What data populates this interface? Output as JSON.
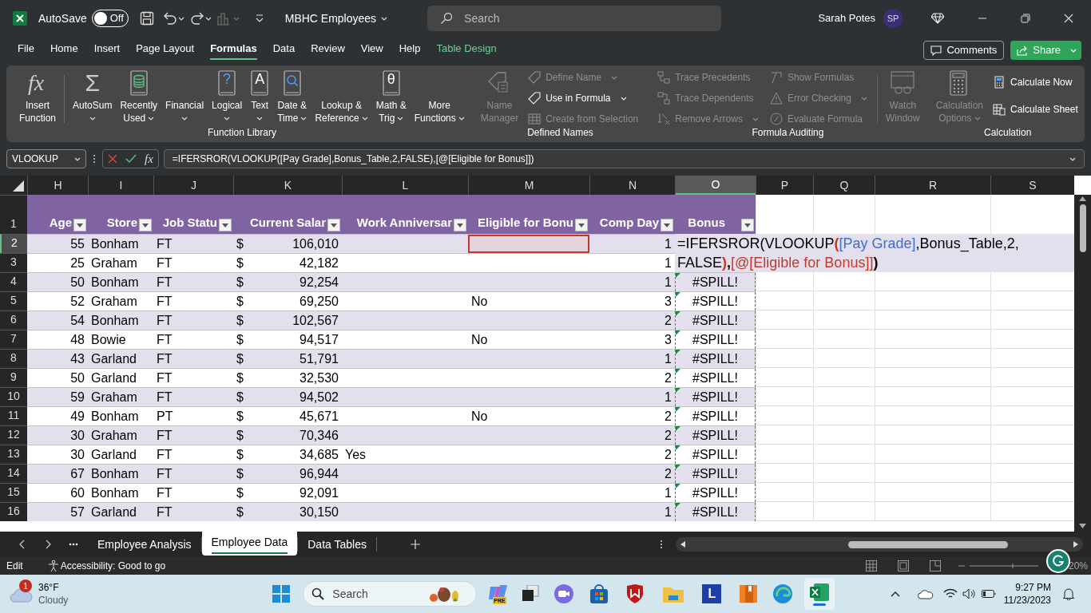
{
  "title_bar": {
    "autosave_label": "AutoSave",
    "autosave": {
      "on": false,
      "label": "Off"
    },
    "file_name": "MBHC Employees",
    "search": {
      "placeholder": "Search"
    },
    "user_name": "Sarah Potes",
    "avatar": "SP"
  },
  "menu_tabs": [
    {
      "label": "File",
      "selected": false,
      "contextual": false
    },
    {
      "label": "Home",
      "selected": false,
      "contextual": false
    },
    {
      "label": "Insert",
      "selected": false,
      "contextual": false
    },
    {
      "label": "Page Layout",
      "selected": false,
      "contextual": false
    },
    {
      "label": "Formulas",
      "selected": true,
      "contextual": false
    },
    {
      "label": "Data",
      "selected": false,
      "contextual": false
    },
    {
      "label": "Review",
      "selected": false,
      "contextual": false
    },
    {
      "label": "View",
      "selected": false,
      "contextual": false
    },
    {
      "label": "Help",
      "selected": false,
      "contextual": false
    },
    {
      "label": "Table Design",
      "selected": false,
      "contextual": true
    }
  ],
  "header_buttons": {
    "comments": "Comments",
    "share": "Share"
  },
  "ribbon": {
    "groups": [
      {
        "label": "Function Library",
        "items": [
          {
            "kind": "large",
            "lines": [
              "Insert",
              "Function"
            ],
            "glyph": "fx",
            "disabled": false,
            "dropdown": false
          },
          {
            "kind": "separator"
          },
          {
            "kind": "large",
            "lines": [
              "AutoSum"
            ],
            "glyph": "Σ",
            "disabled": false,
            "dropdown": true
          },
          {
            "kind": "large",
            "lines": [
              "Recently",
              "Used"
            ],
            "disabled": false,
            "dropdown": true
          },
          {
            "kind": "large",
            "lines": [
              "Financial"
            ],
            "disabled": false,
            "dropdown": true
          },
          {
            "kind": "large",
            "lines": [
              "Logical"
            ],
            "glyph": "?",
            "disabled": false,
            "dropdown": true
          },
          {
            "kind": "large",
            "lines": [
              "Text"
            ],
            "glyph": "A",
            "disabled": false,
            "dropdown": true
          },
          {
            "kind": "large",
            "lines": [
              "Date &",
              "Time"
            ],
            "disabled": false,
            "dropdown": true
          },
          {
            "kind": "large",
            "lines": [
              "Lookup &",
              "Reference"
            ],
            "disabled": false,
            "dropdown": true
          },
          {
            "kind": "large",
            "lines": [
              "Math &",
              "Trig"
            ],
            "glyph": "θ",
            "disabled": false,
            "dropdown": true
          },
          {
            "kind": "large",
            "lines": [
              "More",
              "Functions"
            ],
            "disabled": false,
            "dropdown": true
          }
        ]
      },
      {
        "label": "Defined Names",
        "items": [
          {
            "kind": "large",
            "lines": [
              "Name",
              "Manager"
            ],
            "disabled": true,
            "dropdown": false
          },
          {
            "kind": "stack",
            "items": [
              {
                "label": "Define Name",
                "disabled": true,
                "dropdown": true
              },
              {
                "label": "Use in Formula",
                "disabled": false,
                "dropdown": true
              },
              {
                "label": "Create from Selection",
                "disabled": true,
                "dropdown": false
              }
            ]
          }
        ]
      },
      {
        "label": "Formula Auditing",
        "items": [
          {
            "kind": "stack",
            "items": [
              {
                "label": "Trace Precedents",
                "disabled": true,
                "dropdown": false
              },
              {
                "label": "Trace Dependents",
                "disabled": true,
                "dropdown": false
              },
              {
                "label": "Remove Arrows",
                "disabled": true,
                "dropdown": true
              }
            ]
          },
          {
            "kind": "stack",
            "items": [
              {
                "label": "Show Formulas",
                "disabled": true,
                "dropdown": false
              },
              {
                "label": "Error Checking",
                "disabled": true,
                "dropdown": true
              },
              {
                "label": "Evaluate Formula",
                "disabled": true,
                "dropdown": false
              }
            ]
          },
          {
            "kind": "separator"
          },
          {
            "kind": "large",
            "lines": [
              "Watch",
              "Window"
            ],
            "disabled": true,
            "dropdown": false
          }
        ]
      },
      {
        "label": "Calculation",
        "items": [
          {
            "kind": "large",
            "lines": [
              "Calculation",
              "Options"
            ],
            "disabled": true,
            "dropdown": true
          },
          {
            "kind": "stack",
            "items": [
              {
                "label": "Calculate Now",
                "disabled": false,
                "dropdown": false
              },
              {
                "label": "Calculate Sheet",
                "disabled": false,
                "dropdown": false
              }
            ]
          }
        ]
      }
    ]
  },
  "formula_bar": {
    "name_box": "VLOOKUP",
    "fx": "fx",
    "formula": "=IFERSROR(VLOOKUP([Pay Grade],Bonus_Table,2,FALSE),[@[Eligible for Bonus]])"
  },
  "columns": [
    {
      "label": "H",
      "selected": false
    },
    {
      "label": "I",
      "selected": false
    },
    {
      "label": "J",
      "selected": false
    },
    {
      "label": "K",
      "selected": false
    },
    {
      "label": "L",
      "selected": false
    },
    {
      "label": "M",
      "selected": false
    },
    {
      "label": "N",
      "selected": false
    },
    {
      "label": "O",
      "selected": true
    },
    {
      "label": "P",
      "selected": false
    },
    {
      "label": "Q",
      "selected": false
    },
    {
      "label": "R",
      "selected": false
    },
    {
      "label": "S",
      "selected": false
    }
  ],
  "table_header": {
    "row_number": "1",
    "headers": [
      "Age",
      "Store",
      "Job Statu",
      "Current Salar",
      "Work Anniversar",
      "Eligible for Bonu",
      "Comp Day",
      "Bonus"
    ]
  },
  "rows": [
    {
      "row_number": "2",
      "selected": true,
      "highlight": true,
      "age": "55",
      "store": "Bonham",
      "job_status": "FT",
      "currency": "$",
      "salary": "106,010",
      "comp_day": "1"
    },
    {
      "row_number": "3",
      "selected": false,
      "highlight": false,
      "age": "25",
      "store": "Graham",
      "job_status": "FT",
      "currency": "$",
      "salary": "42,182",
      "comp_day": "1"
    },
    {
      "row_number": "4",
      "selected": false,
      "highlight": false,
      "age": "50",
      "store": "Bonham",
      "job_status": "FT",
      "currency": "$",
      "salary": "92,254",
      "comp_day": "1",
      "bonus": "#SPILL!"
    },
    {
      "row_number": "5",
      "selected": false,
      "highlight": false,
      "age": "52",
      "store": "Graham",
      "job_status": "FT",
      "currency": "$",
      "salary": "69,250",
      "eligible_for_bonus": "No",
      "comp_day": "3",
      "bonus": "#SPILL!"
    },
    {
      "row_number": "6",
      "selected": false,
      "highlight": false,
      "age": "54",
      "store": "Bonham",
      "job_status": "FT",
      "currency": "$",
      "salary": "102,567",
      "comp_day": "2",
      "bonus": "#SPILL!"
    },
    {
      "row_number": "7",
      "selected": false,
      "highlight": false,
      "age": "48",
      "store": "Bowie",
      "job_status": "FT",
      "currency": "$",
      "salary": "94,517",
      "eligible_for_bonus": "No",
      "comp_day": "3",
      "bonus": "#SPILL!"
    },
    {
      "row_number": "8",
      "selected": false,
      "highlight": false,
      "age": "43",
      "store": "Garland",
      "job_status": "FT",
      "currency": "$",
      "salary": "51,791",
      "comp_day": "1",
      "bonus": "#SPILL!"
    },
    {
      "row_number": "9",
      "selected": false,
      "highlight": false,
      "age": "50",
      "store": "Garland",
      "job_status": "FT",
      "currency": "$",
      "salary": "32,530",
      "comp_day": "2",
      "bonus": "#SPILL!"
    },
    {
      "row_number": "10",
      "selected": false,
      "highlight": false,
      "age": "59",
      "store": "Graham",
      "job_status": "FT",
      "currency": "$",
      "salary": "94,502",
      "comp_day": "1",
      "bonus": "#SPILL!"
    },
    {
      "row_number": "11",
      "selected": false,
      "highlight": false,
      "age": "49",
      "store": "Bonham",
      "job_status": "PT",
      "currency": "$",
      "salary": "45,671",
      "eligible_for_bonus": "No",
      "comp_day": "2",
      "bonus": "#SPILL!"
    },
    {
      "row_number": "12",
      "selected": false,
      "highlight": false,
      "age": "30",
      "store": "Graham",
      "job_status": "FT",
      "currency": "$",
      "salary": "70,346",
      "comp_day": "2",
      "bonus": "#SPILL!"
    },
    {
      "row_number": "13",
      "selected": false,
      "highlight": false,
      "age": "30",
      "store": "Garland",
      "job_status": "FT",
      "currency": "$",
      "salary": "34,685",
      "work_anniversary": "Yes",
      "comp_day": "2",
      "bonus": "#SPILL!"
    },
    {
      "row_number": "14",
      "selected": false,
      "highlight": false,
      "age": "67",
      "store": "Bonham",
      "job_status": "FT",
      "currency": "$",
      "salary": "96,944",
      "comp_day": "2",
      "bonus": "#SPILL!"
    },
    {
      "row_number": "15",
      "selected": false,
      "highlight": false,
      "age": "60",
      "store": "Bonham",
      "job_status": "FT",
      "currency": "$",
      "salary": "92,091",
      "comp_day": "1",
      "bonus": "#SPILL!"
    },
    {
      "row_number": "16",
      "selected": false,
      "highlight": false,
      "age": "57",
      "store": "Garland",
      "job_status": "FT",
      "currency": "$",
      "salary": "30,150",
      "comp_day": "1",
      "bonus": "#SPILL!"
    }
  ],
  "cell_editor": {
    "lines": [
      [
        {
          "text": "=IFERSROR(VLOOKUP",
          "color": "#000000"
        },
        {
          "text": "(",
          "color": "#c0392b"
        },
        {
          "text": "[Pay Grade]",
          "color": "#3a6fd8"
        },
        {
          "text": ",Bonus_Table,2,",
          "color": "#000000"
        }
      ],
      [
        {
          "text": "FALSE",
          "color": "#000000"
        },
        {
          "text": ")",
          "color": "#c0392b"
        },
        {
          "text": ",",
          "color": "#000000"
        },
        {
          "text": "[@[Eligible for Bonus]]",
          "color": "#c0392b"
        },
        {
          "text": ")",
          "color": "#000000"
        }
      ]
    ]
  },
  "sheet_tabs": [
    {
      "label": "Employee Analysis",
      "selected": false
    },
    {
      "label": "Employee Data",
      "selected": true
    },
    {
      "label": "Data Tables",
      "selected": false
    }
  ],
  "status_bar": {
    "mode": "Edit",
    "accessibility": "Accessibility: Good to go",
    "zoom": "20%"
  },
  "taskbar": {
    "weather": {
      "temperature": "36°F",
      "condition": "Cloudy",
      "badge": "1"
    },
    "search": {
      "placeholder": "Search"
    },
    "copilot_badge": "PRE",
    "letter_app": "L",
    "time": "9:27 PM",
    "date": "11/23/2023"
  }
}
